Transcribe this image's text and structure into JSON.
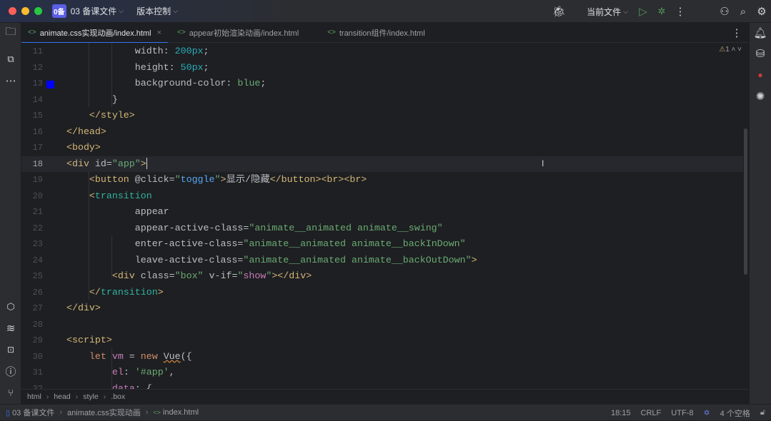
{
  "titlebar": {
    "project_badge": "0备",
    "project_name": "03 备课文件",
    "vcs": "版本控制",
    "run_config": "当前文件"
  },
  "colors": {
    "accent": "#3574f0",
    "swatch": "#0000ff"
  },
  "tabs": [
    {
      "label": "animate.css实现动画/index.html",
      "active": true
    },
    {
      "label": "appear初始渲染动画/index.html",
      "active": false
    },
    {
      "label": "transition组件/index.html",
      "active": false
    }
  ],
  "inspections": {
    "warnings": "1"
  },
  "editor": {
    "current_line": 18,
    "lines": [
      {
        "n": "11",
        "t": [
          [
            "            ",
            "plain"
          ],
          [
            "width: ",
            "attr"
          ],
          [
            "200px",
            "num"
          ],
          [
            ";",
            "plain"
          ]
        ]
      },
      {
        "n": "12",
        "t": [
          [
            "            ",
            "plain"
          ],
          [
            "height: ",
            "attr"
          ],
          [
            "50px",
            "num"
          ],
          [
            ";",
            "plain"
          ]
        ]
      },
      {
        "n": "13",
        "t": [
          [
            "            ",
            "plain"
          ],
          [
            "background-color: ",
            "attr"
          ],
          [
            "blue",
            "str"
          ],
          [
            ";",
            "plain"
          ]
        ]
      },
      {
        "n": "14",
        "t": [
          [
            "        }",
            "plain"
          ]
        ]
      },
      {
        "n": "15",
        "t": [
          [
            "    ",
            "plain"
          ],
          [
            "</style>",
            "tag"
          ]
        ]
      },
      {
        "n": "16",
        "t": [
          [
            "</head>",
            "tag"
          ]
        ]
      },
      {
        "n": "17",
        "t": [
          [
            "<body>",
            "tag"
          ]
        ]
      },
      {
        "n": "18",
        "t": [
          [
            "<div ",
            "tag"
          ],
          [
            "id=",
            "attr"
          ],
          [
            "\"app\"",
            "str"
          ],
          [
            ">",
            "tag"
          ]
        ]
      },
      {
        "n": "19",
        "t": [
          [
            "    ",
            "plain"
          ],
          [
            "<button ",
            "tag"
          ],
          [
            "@click=",
            "attr"
          ],
          [
            "\"",
            "str"
          ],
          [
            "toggle",
            "fn"
          ],
          [
            "\"",
            "str"
          ],
          [
            ">",
            "tag"
          ],
          [
            "显示/隐藏",
            "plain"
          ],
          [
            "</button><br><br>",
            "tag"
          ]
        ]
      },
      {
        "n": "20",
        "t": [
          [
            "    ",
            "plain"
          ],
          [
            "<",
            "tag"
          ],
          [
            "transition",
            "comp"
          ]
        ]
      },
      {
        "n": "21",
        "t": [
          [
            "            appear",
            "attr"
          ]
        ]
      },
      {
        "n": "22",
        "t": [
          [
            "            appear-active-class=",
            "attr"
          ],
          [
            "\"animate__animated animate__swing\"",
            "str"
          ]
        ]
      },
      {
        "n": "23",
        "t": [
          [
            "            enter-active-class=",
            "attr"
          ],
          [
            "\"animate__animated animate__backInDown\"",
            "str"
          ]
        ]
      },
      {
        "n": "24",
        "t": [
          [
            "            leave-active-class=",
            "attr"
          ],
          [
            "\"animate__animated animate__backOutDown\"",
            "str"
          ],
          [
            ">",
            "tag"
          ]
        ]
      },
      {
        "n": "25",
        "t": [
          [
            "        ",
            "plain"
          ],
          [
            "<div ",
            "tag"
          ],
          [
            "class=",
            "attr"
          ],
          [
            "\"box\"",
            "str"
          ],
          [
            " v-if=",
            "attr"
          ],
          [
            "\"",
            "str"
          ],
          [
            "show",
            "pink"
          ],
          [
            "\"",
            "str"
          ],
          [
            "></div>",
            "tag"
          ]
        ]
      },
      {
        "n": "26",
        "t": [
          [
            "    ",
            "plain"
          ],
          [
            "</",
            "tag"
          ],
          [
            "transition",
            "comp"
          ],
          [
            ">",
            "tag"
          ]
        ]
      },
      {
        "n": "27",
        "t": [
          [
            "</div>",
            "tag"
          ]
        ]
      },
      {
        "n": "28",
        "t": []
      },
      {
        "n": "29",
        "t": [
          [
            "<script>",
            "tag"
          ]
        ]
      },
      {
        "n": "30",
        "t": [
          [
            "    ",
            "plain"
          ],
          [
            "let ",
            "kw"
          ],
          [
            "vm",
            "var"
          ],
          [
            " = ",
            "plain"
          ],
          [
            "new ",
            "kw"
          ],
          [
            "Vue",
            "wavy"
          ],
          [
            "({",
            "plain"
          ]
        ]
      },
      {
        "n": "31",
        "t": [
          [
            "        ",
            "plain"
          ],
          [
            "el",
            "var"
          ],
          [
            ": ",
            "plain"
          ],
          [
            "'#app'",
            "str"
          ],
          [
            ",",
            "plain"
          ]
        ]
      },
      {
        "n": "32",
        "t": [
          [
            "        ",
            "plain"
          ],
          [
            "data",
            "var"
          ],
          [
            ": {",
            "plain"
          ]
        ]
      }
    ]
  },
  "breadcrumbs": [
    "html",
    "head",
    "style",
    ".box"
  ],
  "status": {
    "path": [
      "03 备课文件",
      "animate.css实现动画",
      "index.html"
    ],
    "position": "18:15",
    "line_sep": "CRLF",
    "encoding": "UTF-8",
    "indent": "4 个空格"
  }
}
